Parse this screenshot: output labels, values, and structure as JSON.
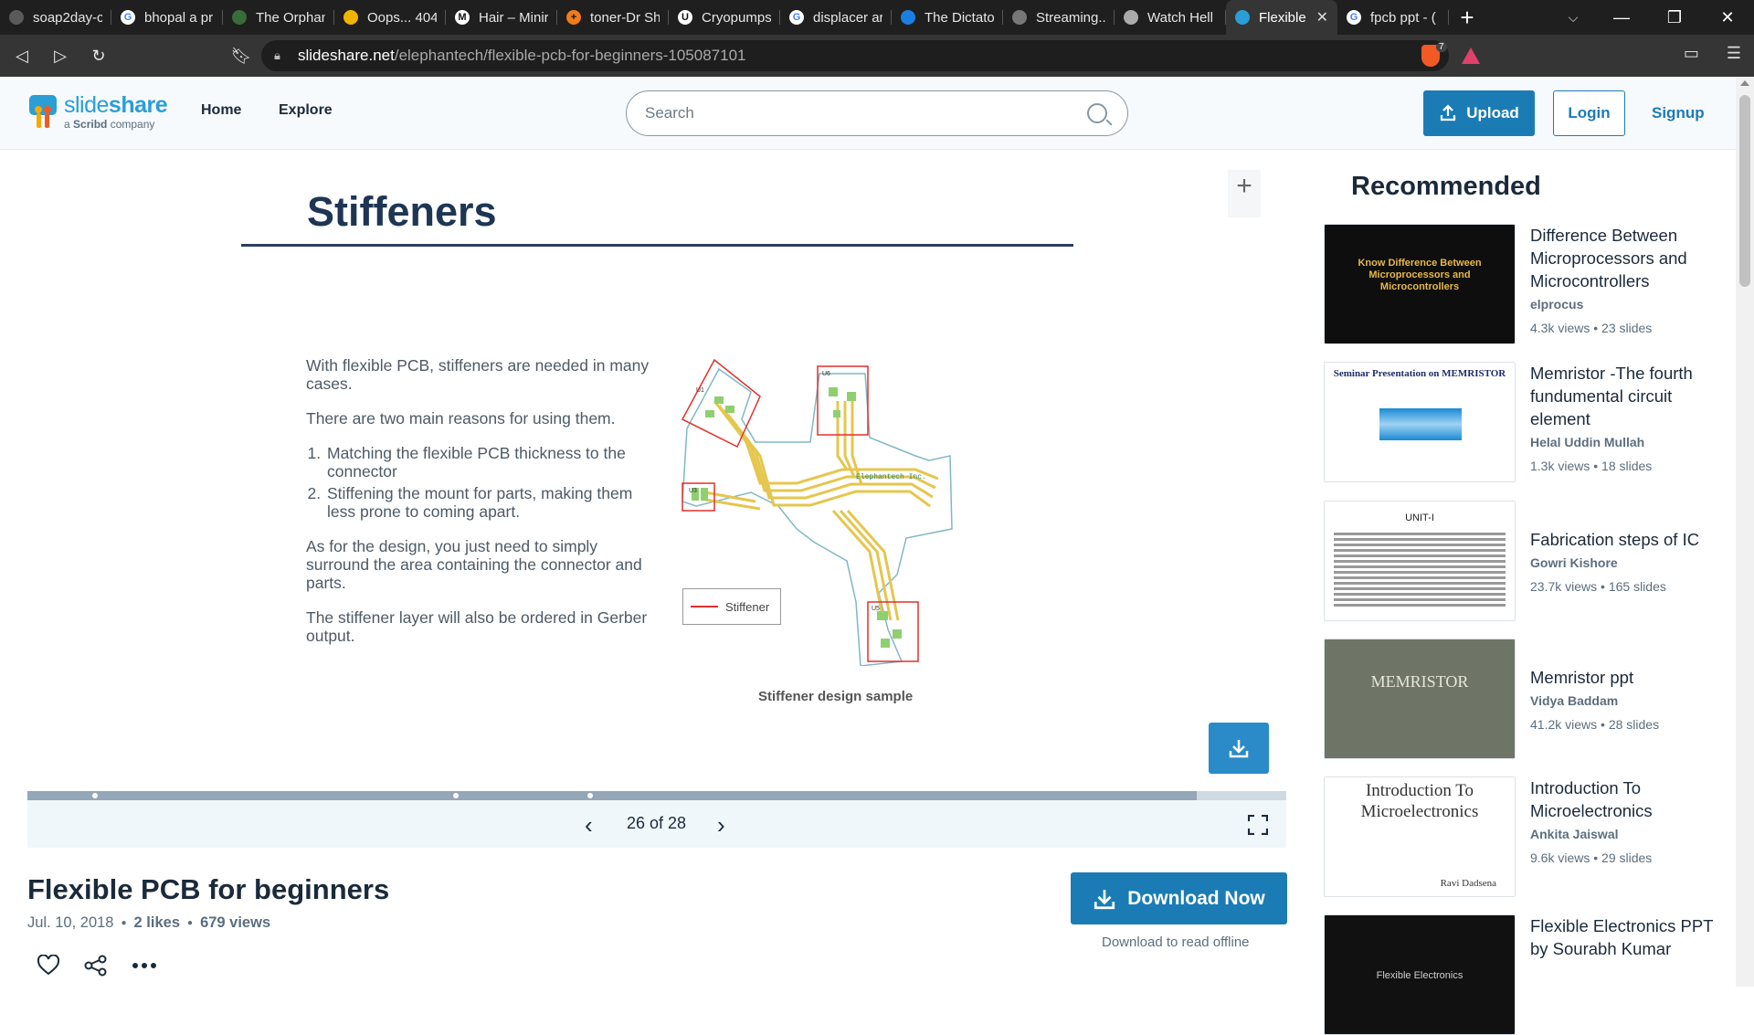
{
  "browser": {
    "tabs": [
      {
        "label": "soap2day-c",
        "fav_color": "#5a5a5a",
        "fav_text": ""
      },
      {
        "label": "bhopal a pr",
        "fav_color": "#ffffff",
        "fav_text": "G"
      },
      {
        "label": "The Orphan",
        "fav_color": "#3a6b3a",
        "fav_text": ""
      },
      {
        "label": "Oops... 404",
        "fav_color": "#f0b400",
        "fav_text": ""
      },
      {
        "label": "Hair – Minir",
        "fav_color": "#ffffff",
        "fav_text": "M"
      },
      {
        "label": "toner-Dr Sh",
        "fav_color": "#f07c1a",
        "fav_text": "+"
      },
      {
        "label": "Cryopumps",
        "fav_color": "#ffffff",
        "fav_text": "U"
      },
      {
        "label": "displacer ar",
        "fav_color": "#ffffff",
        "fav_text": "G"
      },
      {
        "label": "The Dictato",
        "fav_color": "#1a7fe0",
        "fav_text": ""
      },
      {
        "label": "Streaming...",
        "fav_color": "#777777",
        "fav_text": ""
      },
      {
        "label": "Watch Hell",
        "fav_color": "#aaaaaa",
        "fav_text": ""
      },
      {
        "label": "Flexible",
        "fav_color": "#2a9ed5",
        "fav_text": "",
        "active": true
      },
      {
        "label": "fpcb ppt - (",
        "fav_color": "#ffffff",
        "fav_text": "G"
      }
    ],
    "url_domain": "slideshare.net",
    "url_path": "/elephantech/flexible-pcb-for-beginners-105087101",
    "brave_badge": "7"
  },
  "header": {
    "brand": "slide",
    "brand_bold": "share",
    "brand_sub_prefix": "a ",
    "brand_sub_bold": "Scribd",
    "brand_sub_suffix": " company",
    "nav": [
      "Home",
      "Explore"
    ],
    "search_placeholder": "Search",
    "upload_label": "Upload",
    "login_label": "Login",
    "signup_label": "Signup"
  },
  "slide": {
    "title": "Stiffeners",
    "para1": "With flexible PCB, stiffeners are needed in many cases.",
    "para2": "There are two main reasons for using them.",
    "list": [
      "Matching the flexible PCB thickness to the connector",
      "Stiffening the mount for parts, making them less prone to coming apart."
    ],
    "para3": "As for the design, you just need to simply surround the area containing the connector and parts.",
    "para4": "The stiffener layer will also be ordered in Gerber output.",
    "legend_label": "Stiffener",
    "caption": "Stiffener design sample",
    "pcb_text": "Elephantech Inc.",
    "pcb_labels": [
      "U1",
      "U6",
      "U3",
      "U5"
    ],
    "stiffener_color": "#e0302d",
    "trace_color": "#e5c64e"
  },
  "viewer": {
    "page_current": "26",
    "page_sep": " of ",
    "page_total": "28",
    "progress_fraction": 0.929
  },
  "document": {
    "title": "Flexible PCB for beginners",
    "date": "Jul. 10, 2018",
    "likes": "2 likes",
    "views": "679 views",
    "download_label": "Download Now",
    "download_sub": "Download to read offline"
  },
  "recommended": {
    "heading": "Recommended",
    "items": [
      {
        "title": "Difference Between Microprocessors and Microcontrollers",
        "author": "elprocus",
        "stats": "4.3k views • 23 slides",
        "thumb_text": "Know Difference Between Microprocessors and Microcontrollers",
        "thumb_bg": "#0e0e0e",
        "thumb_fg": "#e7b84a"
      },
      {
        "title": "Memristor -The fourth fundumental circuit element",
        "author": "Helal Uddin Mullah",
        "stats": "1.3k views • 18 slides",
        "thumb_text": "Seminar Presentation on MEMRISTOR",
        "thumb_bg": "#ffffff",
        "thumb_fg": "#1f2d6b"
      },
      {
        "title": "Fabrication steps of IC",
        "author": "Gowri Kishore",
        "stats": "23.7k views • 165 slides",
        "thumb_text": "UNIT-I",
        "thumb_bg": "#ffffff",
        "thumb_fg": "#222222"
      },
      {
        "title": "Memristor ppt",
        "author": "Vidya Baddam",
        "stats": "41.2k views • 28 slides",
        "thumb_text": "MEMRISTOR",
        "thumb_bg": "#6f7566",
        "thumb_fg": "#e6e6da"
      },
      {
        "title": "Introduction To Microelectronics",
        "author": "Ankita Jaiswal",
        "stats": "9.6k views • 29 slides",
        "thumb_text": "Introduction To Microelectronics",
        "thumb_sub": "Ravi Dadsena",
        "thumb_bg": "#ffffff",
        "thumb_fg": "#333333"
      },
      {
        "title": "Flexible Electronics PPT by Sourabh Kumar",
        "author": "",
        "stats": "",
        "thumb_text": "Flexible Electronics",
        "thumb_bg": "#111111",
        "thumb_fg": "#cfcfcf"
      }
    ]
  }
}
